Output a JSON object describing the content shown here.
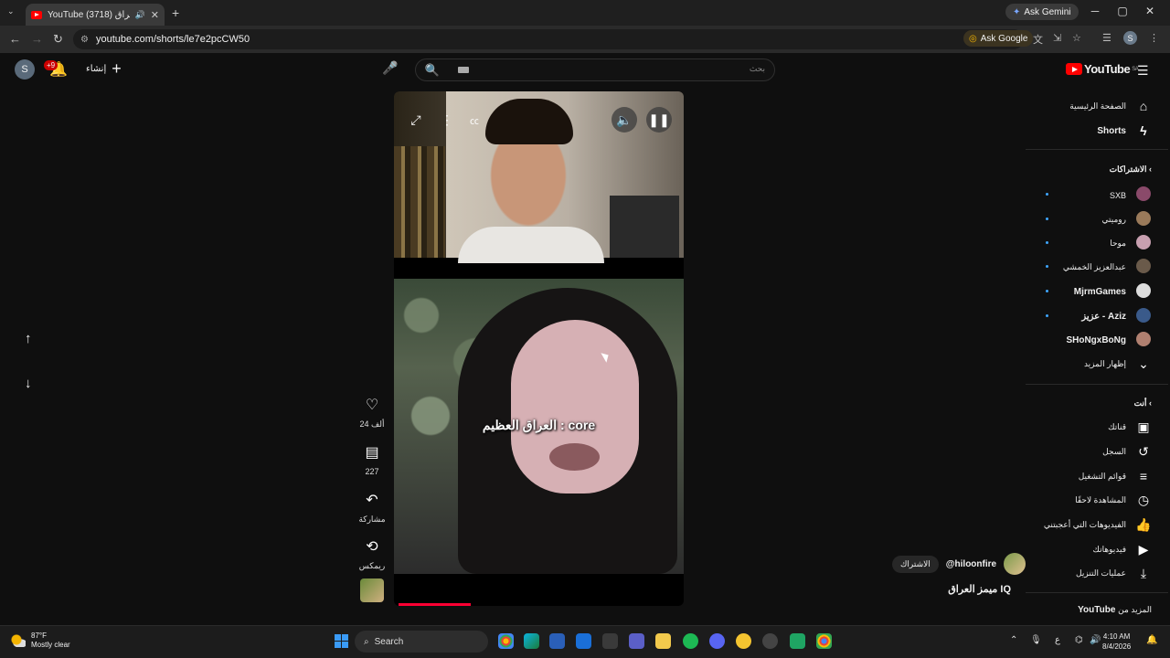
{
  "browser": {
    "tab_title": "YouTube ميمز العراق (3718)",
    "url": "youtube.com/shorts/le7e2pcCW50",
    "ask_gemini": "Ask Gemini",
    "ask_google": "Ask Google",
    "profile_initial": "S"
  },
  "header": {
    "avatar_initial": "S",
    "notif_badge": "+9",
    "create_label": "إنشاء",
    "search_placeholder": "بحث",
    "logo_text": "YouTube",
    "logo_region": "SA"
  },
  "video": {
    "caption": "العراق العظيم : core",
    "progress_fraction": 0.25
  },
  "actions": {
    "likes": "24 ألف",
    "comments": "227",
    "share": "مشاركة",
    "remix": "ريمكس"
  },
  "channel": {
    "handle": "@hiloonfire",
    "subscribe": "الاشتراك",
    "title": "ميمز العراق IQ"
  },
  "sidebar": {
    "home": "الصفحة الرئيسية",
    "shorts": "Shorts",
    "subscriptions_header": "الاشتراكات",
    "subs": [
      {
        "name": "SXB",
        "color": "#8a4a6a"
      },
      {
        "name": "روميتي",
        "color": "#9a7a5a"
      },
      {
        "name": "موحا",
        "color": "#c8a0b0"
      },
      {
        "name": "عبدالعزيز الخمشي",
        "color": "#6a5a4a"
      },
      {
        "name": "MjrmGames",
        "color": "#dddddd"
      },
      {
        "name": "عزيز - Aziz",
        "color": "#3a5a8a"
      },
      {
        "name": "SHoNgxBoNg",
        "color": "#b08070"
      }
    ],
    "show_more": "إظهار المزيد",
    "you_header": "أنت",
    "you_items": [
      {
        "label": "قناتك",
        "icon": "channel-icon"
      },
      {
        "label": "السجل",
        "icon": "history-icon"
      },
      {
        "label": "قوائم التشغيل",
        "icon": "playlists-icon"
      },
      {
        "label": "المشاهدة لاحقًا",
        "icon": "watch-later-icon"
      },
      {
        "label": "الفيديوهات التي أعجبتني",
        "icon": "liked-icon"
      },
      {
        "label": "فيديوهاتك",
        "icon": "your-videos-icon"
      },
      {
        "label": "عمليات التنزيل",
        "icon": "downloads-icon"
      }
    ],
    "more_from": "المزيد من",
    "more_from_brand": "YouTube"
  },
  "taskbar": {
    "temp": "87°F",
    "condition": "Mostly clear",
    "search": "Search",
    "lang": "ع",
    "time": "4:10 AM",
    "date": "8/4/2026"
  }
}
